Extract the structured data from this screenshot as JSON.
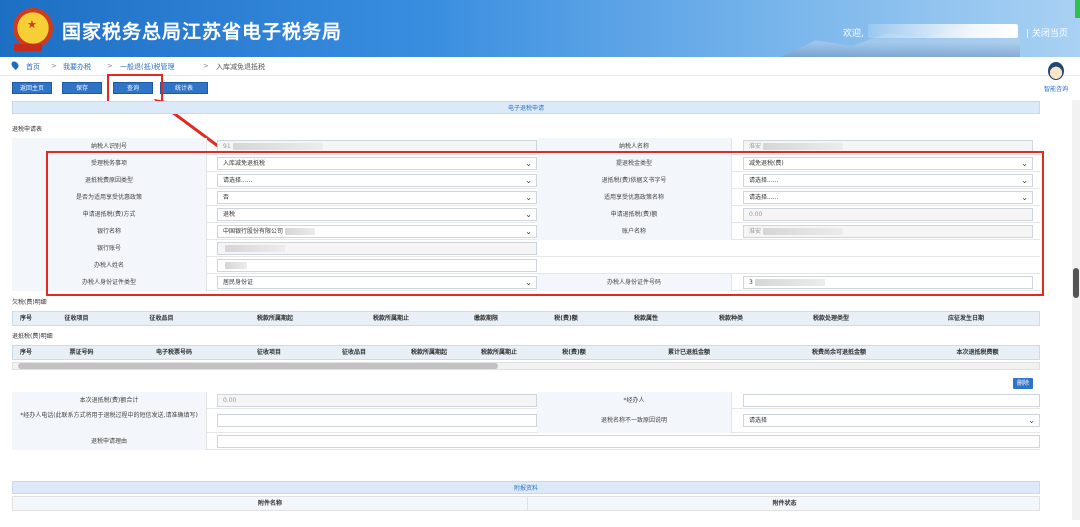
{
  "header": {
    "site_title": "国家税务总局江苏省电子税务局",
    "welcome": "欢迎,",
    "close_page": "| 关闭当页"
  },
  "breadcrumb": [
    "首页",
    ">",
    "我要办税",
    ">",
    "一般退(抵)税管理",
    ">",
    "入库减免退抵税"
  ],
  "toolbar": {
    "home": "返回主页",
    "save": "保存",
    "query": "查询",
    "stats": "统计表"
  },
  "assistant": {
    "label": "智能咨询"
  },
  "colors": {
    "accent": "#2f74c6",
    "highlight": "#e02a22"
  },
  "main": {
    "title": "电子退税申请",
    "section_apply": "退税申请表",
    "rows": [
      {
        "l1": "纳税人识别号",
        "v1": "91",
        "l2": "纳税人名称",
        "v2": "淮安"
      },
      {
        "l1": "受理税务事项",
        "v1": "入库减免退抵税",
        "l2": "提退税金类型",
        "v2": "减免退税(费)"
      },
      {
        "l1": "退抵税费原因类型",
        "v1": "请选择......",
        "l2": "退抵税(费)依据文书字号",
        "v2": "请选择......"
      },
      {
        "l1": "是否为适用享受优惠政策",
        "v1": "否",
        "l2": "适用享受优惠政策名称",
        "v2": "请选择......"
      },
      {
        "l1": "申请退抵税(费)方式",
        "v1": "退税",
        "l2": "申请退抵税(费)额",
        "v2": "0.00"
      },
      {
        "l1": "银行名称",
        "v1": "中国银行股份有限公司",
        "l2": "账户名称",
        "v2": "淮安"
      },
      {
        "l1": "银行账号",
        "v1": "",
        "l2": "",
        "v2": ""
      },
      {
        "l1": "办税人姓名",
        "v1": "",
        "l2": "",
        "v2": ""
      },
      {
        "l1": "办税人身份证件类型",
        "v1": "居民身份证",
        "l2": "办税人身份证件号码",
        "v2": "3"
      }
    ],
    "owed_title": "欠税(费)明细",
    "owed_cols": [
      "序号",
      "征收项目",
      "征收品目",
      "税款所属期起",
      "税款所属期止",
      "缴款期限",
      "税(费)额",
      "税款属性",
      "税款种类",
      "税款处理类型",
      "应征发生日期"
    ],
    "refund_title": "退抵税(费)明细",
    "refund_cols": [
      "序号",
      "票证号码",
      "电子税票号码",
      "征收项目",
      "征收品目",
      "税款所属期起",
      "税款所属期止",
      "税(费)额",
      "累计已退抵金额",
      "税费尚余可退抵金额",
      "本次退抵税费额"
    ],
    "delete": "删除",
    "bottom": {
      "total_label": "本次退抵税(费)额合计",
      "total_value": "0.00",
      "handler_label": "*经办人",
      "phone_label": "*经办人电话(此联系方式将用于退税过程中的短信发送,请准确填写)",
      "mismatch_label": "退税名称不一致原因说明",
      "mismatch_value": "请选择",
      "reason_label": "退税申请理由"
    },
    "attach": {
      "title": "附报资料",
      "col1": "附件名称",
      "col2": "附件状态"
    }
  }
}
